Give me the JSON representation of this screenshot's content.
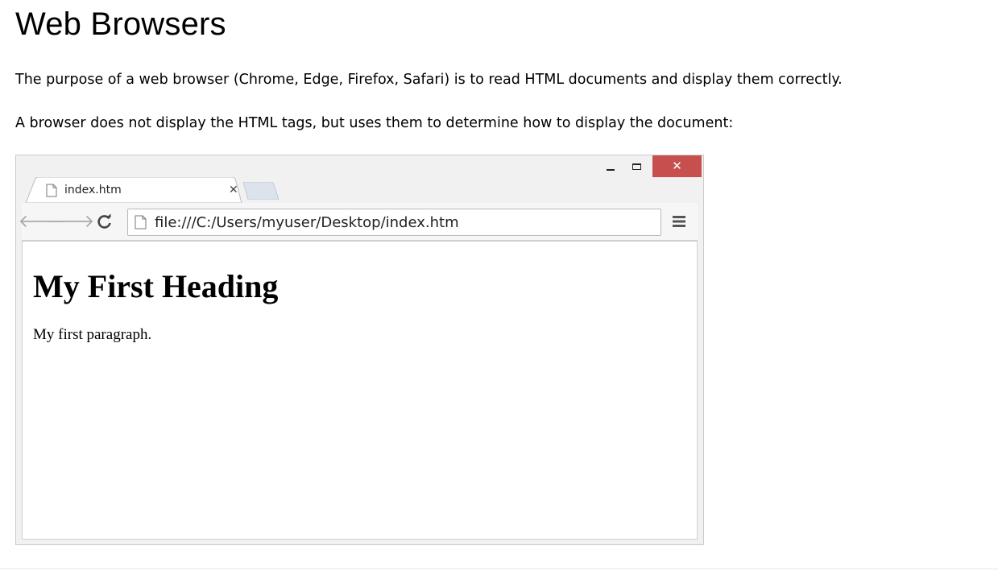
{
  "page": {
    "title": "Web Browsers",
    "paragraphs": [
      "The purpose of a web browser (Chrome, Edge, Firefox, Safari) is to read HTML documents and display them correctly.",
      "A browser does not display the HTML tags, but uses them to determine how to display the document:"
    ]
  },
  "browser": {
    "window_controls": {
      "minimize_icon": "minimize-icon",
      "maximize_icon": "maximize-icon",
      "close_glyph": "✕"
    },
    "tab": {
      "label": "index.htm",
      "icon": "file-icon",
      "close_glyph": "✕"
    },
    "toolbar": {
      "back_glyph": "🡐",
      "forward_glyph": "🡒",
      "reload_glyph": "C",
      "menu_icon": "hamburger-menu-icon"
    },
    "address": {
      "url": "file:///C:/Users/myuser/Desktop/index.htm",
      "icon": "file-icon"
    },
    "content": {
      "heading": "My First Heading",
      "paragraph": "My first paragraph."
    }
  },
  "colors": {
    "close_button": "#c7504f",
    "frame_border": "#c9c9c9",
    "chrome_bg": "#f1f1f1",
    "nav_disabled": "#a9a9a9"
  }
}
